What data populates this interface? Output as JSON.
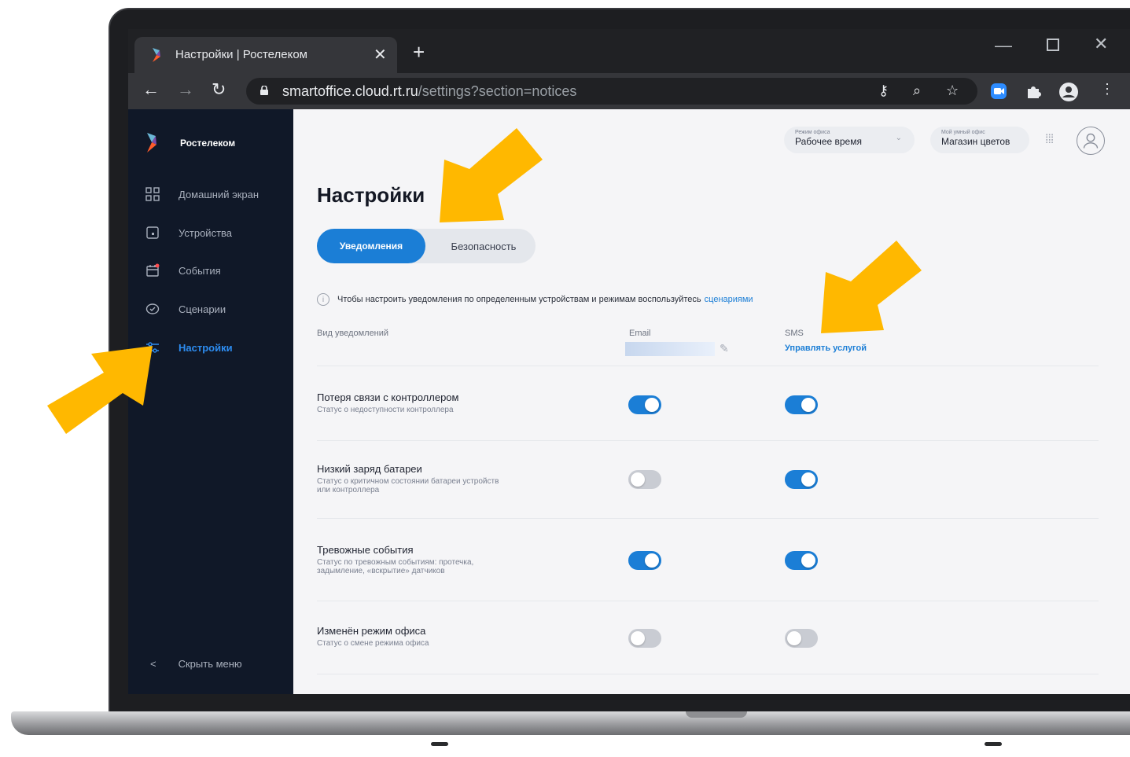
{
  "browser": {
    "tab_title": "Настройки | Ростелеком",
    "tab_close": "✕",
    "new_tab": "+",
    "url_host": "smartoffice.cloud.rt.ru",
    "url_path": "/settings?section=notices"
  },
  "sidebar": {
    "brand": "Ростелеком",
    "items": [
      {
        "label": "Домашний экран",
        "icon": "grid-icon"
      },
      {
        "label": "Устройства",
        "icon": "device-icon"
      },
      {
        "label": "События",
        "icon": "calendar-icon"
      },
      {
        "label": "Сценарии",
        "icon": "scenario-icon"
      },
      {
        "label": "Настройки",
        "icon": "settings-icon",
        "active": true
      }
    ],
    "hide_menu": "Скрыть меню",
    "hide_chevron": "<"
  },
  "header": {
    "office_mode_label": "Режим офиса",
    "office_mode_value": "Рабочее время",
    "smart_office_label": "Мой умный офис",
    "smart_office_value": "Магазин цветов"
  },
  "page": {
    "title": "Настройки",
    "tabs": [
      "Уведомления",
      "Безопасность"
    ],
    "hint_text": "Чтобы настроить уведомления по определенным устройствам и режимам воспользуйтесь",
    "hint_link": "сценариями",
    "col_type": "Вид уведомлений",
    "col_email": "Email",
    "col_sms": "SMS",
    "manage_service": "Управлять услугой"
  },
  "notifications": [
    {
      "title": "Потеря связи с контроллером",
      "subtitle": "Статус о недоступности контроллера",
      "email": true,
      "sms": true
    },
    {
      "title": "Низкий заряд батареи",
      "subtitle": "Статус о критичном состоянии батареи устройств или контроллера",
      "email": false,
      "sms": true
    },
    {
      "title": "Тревожные события",
      "subtitle": "Статус по тревожным событиям: протечка, задымление, «вскрытие» датчиков",
      "email": true,
      "sms": true
    },
    {
      "title": "Изменён режим офиса",
      "subtitle": "Статус о смене режима офиса",
      "email": false,
      "sms": false
    }
  ],
  "colors": {
    "accent": "#1b7ed6",
    "sidebar_bg": "#101828",
    "arrow": "#ffb800"
  }
}
